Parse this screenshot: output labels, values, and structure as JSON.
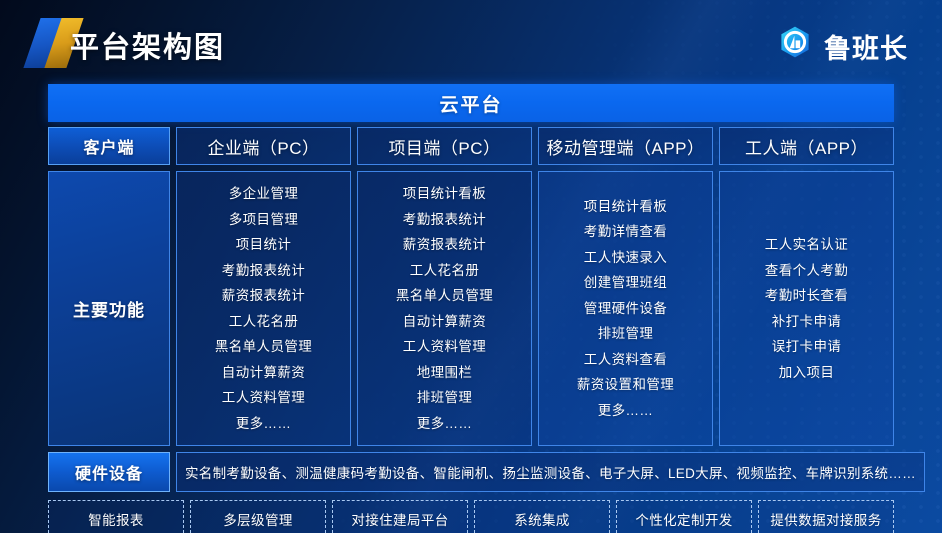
{
  "header": {
    "title": "平台架构图",
    "logo_mark_icon": "parallelogram-logo-icon",
    "brand_icon": "hexagon-building-logo-icon",
    "brand_name": "鲁班长"
  },
  "cloud_bar": {
    "label": "云平台"
  },
  "client_row": {
    "label": "客户端",
    "columns": [
      {
        "label": "企业端（PC）"
      },
      {
        "label": "项目端（PC）"
      },
      {
        "label": "移动管理端（APP）"
      },
      {
        "label": "工人端（APP）"
      }
    ]
  },
  "functions_row": {
    "label": "主要功能",
    "columns": [
      {
        "items": [
          "多企业管理",
          "多项目管理",
          "项目统计",
          "考勤报表统计",
          "薪资报表统计",
          "工人花名册",
          "黑名单人员管理",
          "自动计算薪资",
          "工人资料管理",
          "更多……"
        ]
      },
      {
        "items": [
          "项目统计看板",
          "考勤报表统计",
          "薪资报表统计",
          "工人花名册",
          "黑名单人员管理",
          "自动计算薪资",
          "工人资料管理",
          "地理围栏",
          "排班管理",
          "更多……"
        ]
      },
      {
        "items": [
          "项目统计看板",
          "考勤详情查看",
          "工人快速录入",
          "创建管理班组",
          "管理硬件设备",
          "排班管理",
          "工人资料查看",
          "薪资设置和管理",
          "更多……"
        ]
      },
      {
        "items": [
          "工人实名认证",
          "查看个人考勤",
          "考勤时长查看",
          "补打卡申请",
          "误打卡申请",
          "加入项目"
        ]
      }
    ]
  },
  "hardware_row": {
    "label": "硬件设备",
    "list": "实名制考勤设备、测温健康码考勤设备、智能闸机、扬尘监测设备、电子大屏、LED大屏、视频监控、车牌识别系统……"
  },
  "services_row": {
    "items": [
      "智能报表",
      "多层级管理",
      "对接住建局平台",
      "系统集成",
      "个性化定制开发",
      "提供数据对接服务"
    ]
  },
  "colors": {
    "accent_blue": "#0a68ef",
    "panel_border": "#3f85e8",
    "label_blue": "#0d4fbb",
    "gold": "#d99c1a",
    "background_dark": "#020a1c",
    "background_light": "#0b4aa1",
    "text_white": "#ffffff"
  }
}
